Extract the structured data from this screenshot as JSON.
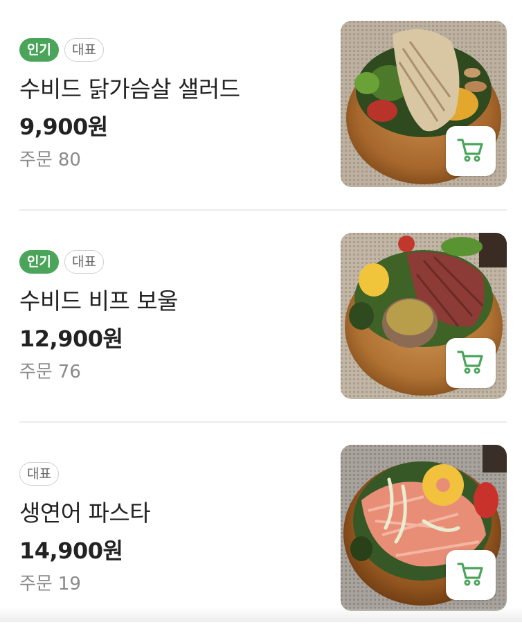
{
  "theme": {
    "accent": "#4aa45a",
    "text": "#222222",
    "muted": "#8a8a8a"
  },
  "menu": {
    "items": [
      {
        "badges": [
          "인기",
          "대표"
        ],
        "name": "수비드 닭가슴살 샐러드",
        "price": "9,900원",
        "orders_label": "주문",
        "orders_count": "80",
        "image": "chicken-breast-salad-photo",
        "cart_icon": "cart-icon"
      },
      {
        "badges": [
          "인기",
          "대표"
        ],
        "name": "수비드 비프 보울",
        "price": "12,900원",
        "orders_label": "주문",
        "orders_count": "76",
        "image": "beef-bowl-photo",
        "cart_icon": "cart-icon"
      },
      {
        "badges": [
          "대표"
        ],
        "name": "생연어 파스타",
        "price": "14,900원",
        "orders_label": "주문",
        "orders_count": "19",
        "image": "salmon-pasta-photo",
        "cart_icon": "cart-icon"
      }
    ]
  }
}
